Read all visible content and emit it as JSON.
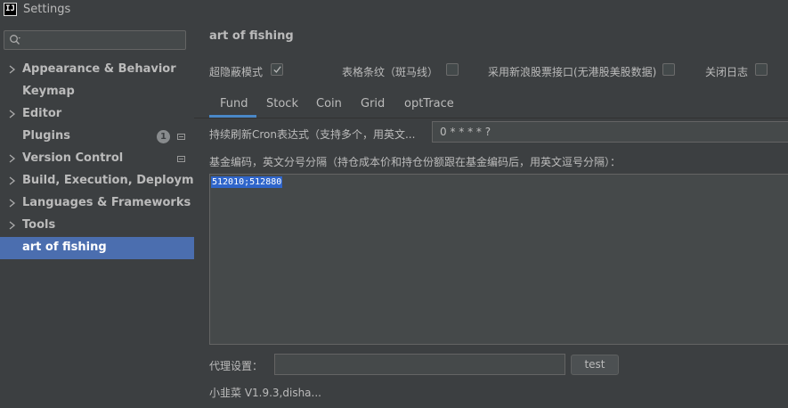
{
  "window": {
    "title": "Settings",
    "app_icon_text": "IJ"
  },
  "sidebar": {
    "search": {
      "placeholder": ""
    },
    "items": [
      {
        "label": "Appearance & Behavior",
        "expandable": true
      },
      {
        "label": "Keymap",
        "expandable": false
      },
      {
        "label": "Editor",
        "expandable": true
      },
      {
        "label": "Plugins",
        "expandable": false,
        "badge": "1"
      },
      {
        "label": "Version Control",
        "expandable": true
      },
      {
        "label": "Build, Execution, Deployment",
        "expandable": true
      },
      {
        "label": "Languages & Frameworks",
        "expandable": true
      },
      {
        "label": "Tools",
        "expandable": true
      },
      {
        "label": "art of fishing",
        "expandable": false,
        "selected": true
      }
    ]
  },
  "main": {
    "heading": "art of fishing",
    "options": [
      {
        "label": "超隐蔽模式",
        "checked": true
      },
      {
        "label": "表格条纹（斑马线）",
        "checked": false
      },
      {
        "label": "采用新浪股票接口(无港股美股数据)",
        "checked": false
      },
      {
        "label": "关闭日志",
        "checked": false
      }
    ],
    "tabs": [
      "Fund",
      "Stock",
      "Coin",
      "Grid",
      "optTrace"
    ],
    "active_tab": "Fund",
    "cron_label": "持续刷新Cron表达式（支持多个，用英文...",
    "cron_value": "0 * * * * ?",
    "fund_label": "基金编码，英文分号分隔（持仓成本价和持仓份额跟在基金编码后，用英文逗号分隔）：",
    "fund_value": "512010;512880",
    "proxy_label": "代理设置：",
    "proxy_value": "",
    "test_button": "test",
    "version": "小韭菜 V1.9.3,disha..."
  },
  "colors": {
    "accent": "#4b6eaf",
    "tab_underline": "#4a88c7",
    "selection": "#2f65ca",
    "background": "#3c3f41"
  }
}
